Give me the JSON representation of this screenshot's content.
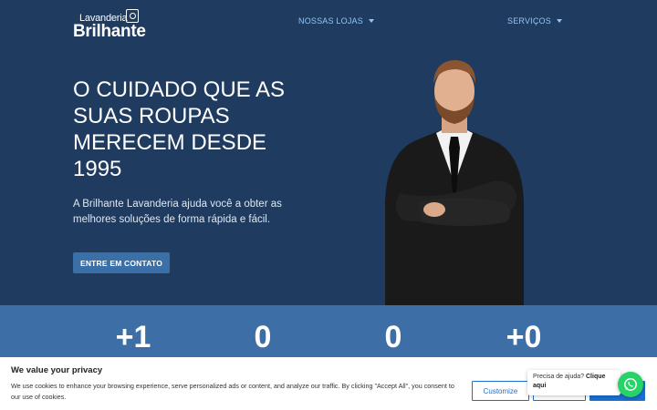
{
  "brand": {
    "small": "Lavanderia",
    "big": "Brilhante"
  },
  "nav": {
    "stores": "NOSSAS LOJAS",
    "services": "SERVIÇOS"
  },
  "hero": {
    "headline": "O CUIDADO QUE AS SUAS ROUPAS MERECEM DESDE 1995",
    "subtitle": "A Brilhante Lavanderia ajuda você a obter as melhores soluções de forma rápida e fácil.",
    "cta": "ENTRE EM CONTATO"
  },
  "stats": [
    "+1",
    "0",
    "0",
    "+0"
  ],
  "cookie": {
    "title": "We value your privacy",
    "text": "We use cookies to enhance your browsing experience, serve personalized ads or content, and analyze our traffic. By clicking \"Accept All\", you consent to our use of cookies.",
    "customize": "Customize",
    "reject": "",
    "accept": "Ac"
  },
  "help": {
    "text": "Precisa de ajuda?",
    "link": "Clique aqui"
  },
  "colors": {
    "hero_bg": "#1f3b60",
    "stats_bg": "#3d6fa6",
    "accent": "#3a6fa8",
    "nav": "#8ec9f5",
    "whatsapp": "#25d366"
  }
}
